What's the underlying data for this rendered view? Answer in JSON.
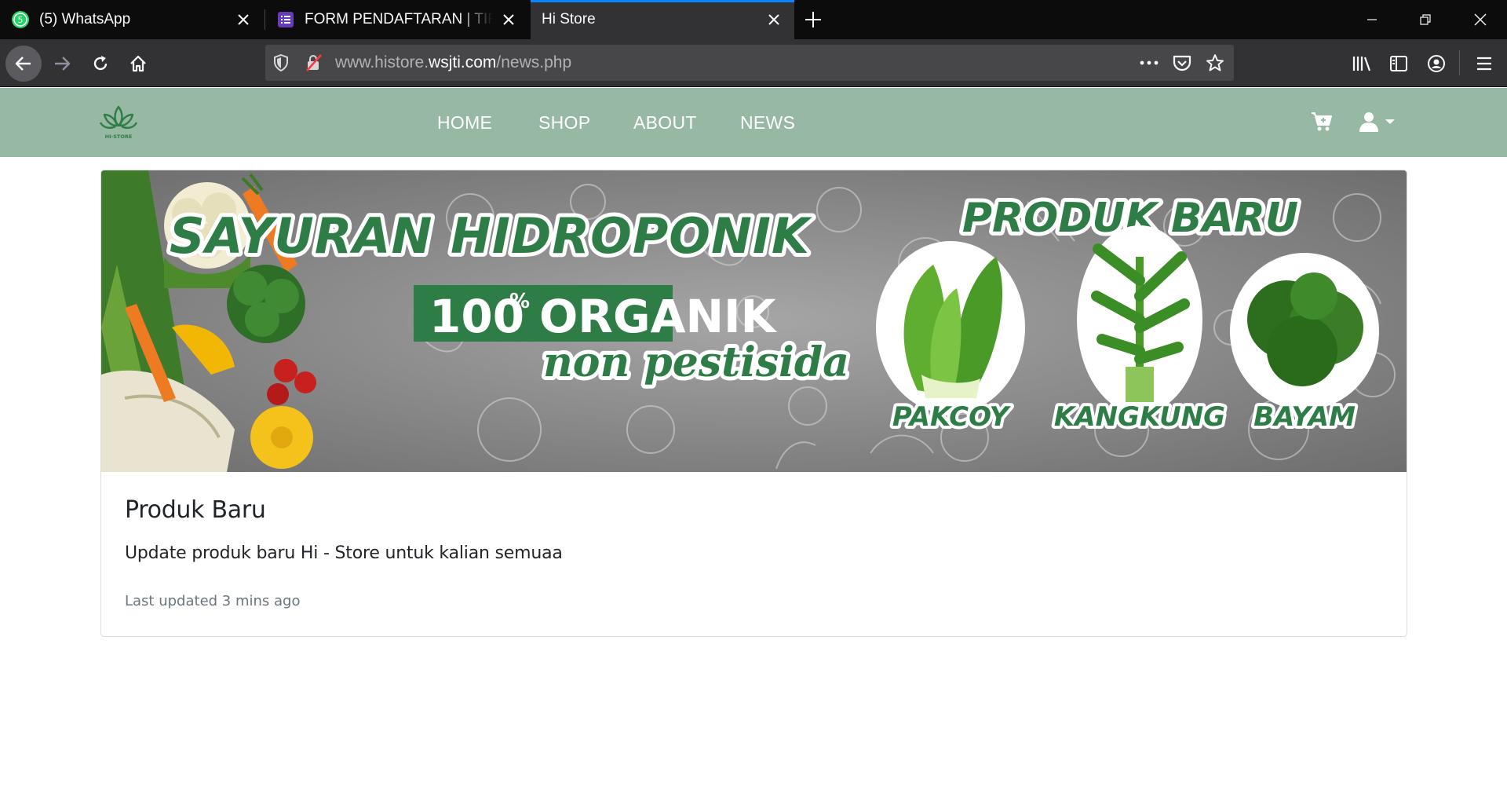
{
  "browser": {
    "tabs": [
      {
        "title": "(5) WhatsApp",
        "badge": "5",
        "active": false
      },
      {
        "title": "FORM PENDAFTARAN | TIF EXHIBITION",
        "active": false
      },
      {
        "title": "Hi Store",
        "active": true
      }
    ],
    "url": {
      "prefix": "www.histore.",
      "domain": "wsjti.com",
      "path": "/news.php"
    },
    "accent": "#0a84ff"
  },
  "site": {
    "logo_text": "HI-STORE",
    "nav": {
      "items": [
        "HOME",
        "SHOP",
        "ABOUT",
        "NEWS"
      ],
      "bg_color": "#97b8a3"
    },
    "banner": {
      "headline": "SAYURAN HIDROPONIK",
      "badge": "100% ORGANIK",
      "badge_number": "100",
      "badge_percent": "%",
      "badge_word": "ORGANIK",
      "sub": "non pestisida",
      "products_title": "PRODUK BARU",
      "products": [
        "PAKCOY",
        "KANGKUNG",
        "BAYAM"
      ],
      "brand_green": "#2e7d46"
    },
    "card": {
      "title": "Produk Baru",
      "text": "Update produk baru Hi - Store untuk kalian semuaa",
      "updated": "Last updated 3 mins ago"
    }
  }
}
